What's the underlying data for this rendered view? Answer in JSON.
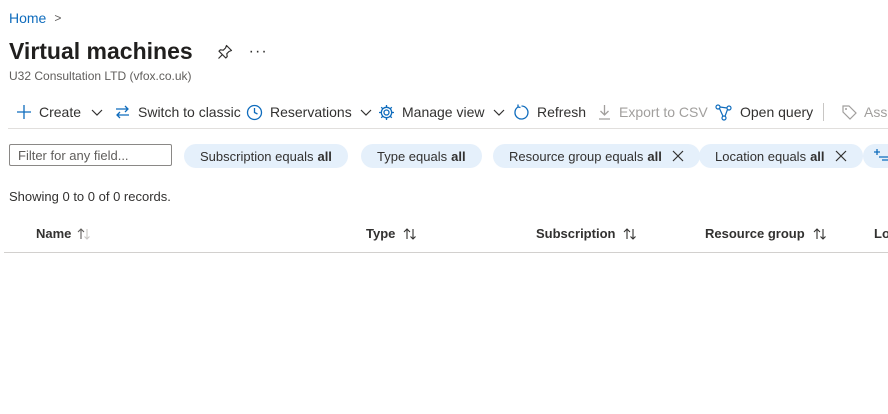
{
  "breadcrumb": {
    "home": "Home",
    "chevron": ">"
  },
  "page": {
    "title": "Virtual machines",
    "more": "···",
    "subtitle": "U32 Consultation LTD (vfox.co.uk)"
  },
  "toolbar": {
    "create": "Create",
    "switch_classic": "Switch to classic",
    "reservations": "Reservations",
    "manage_view": "Manage view",
    "refresh": "Refresh",
    "export_csv": "Export to CSV",
    "open_query": "Open query",
    "assign_tags": "Assi"
  },
  "filter": {
    "placeholder": "Filter for any field...",
    "pills": [
      {
        "prefix": "Subscription equals",
        "value": "all"
      },
      {
        "prefix": "Type equals",
        "value": "all"
      },
      {
        "prefix": "Resource group equals",
        "value": "all"
      },
      {
        "prefix": "Location equals",
        "value": "all"
      }
    ]
  },
  "records_text": "Showing 0 to 0 of 0 records.",
  "table": {
    "columns": [
      "Name",
      "Type",
      "Subscription",
      "Resource group",
      "Lo"
    ]
  },
  "colors": {
    "accent": "#0f6cbd",
    "pill_bg": "#e5f0fb",
    "text": "#323130",
    "disabled": "#a19f9d"
  }
}
